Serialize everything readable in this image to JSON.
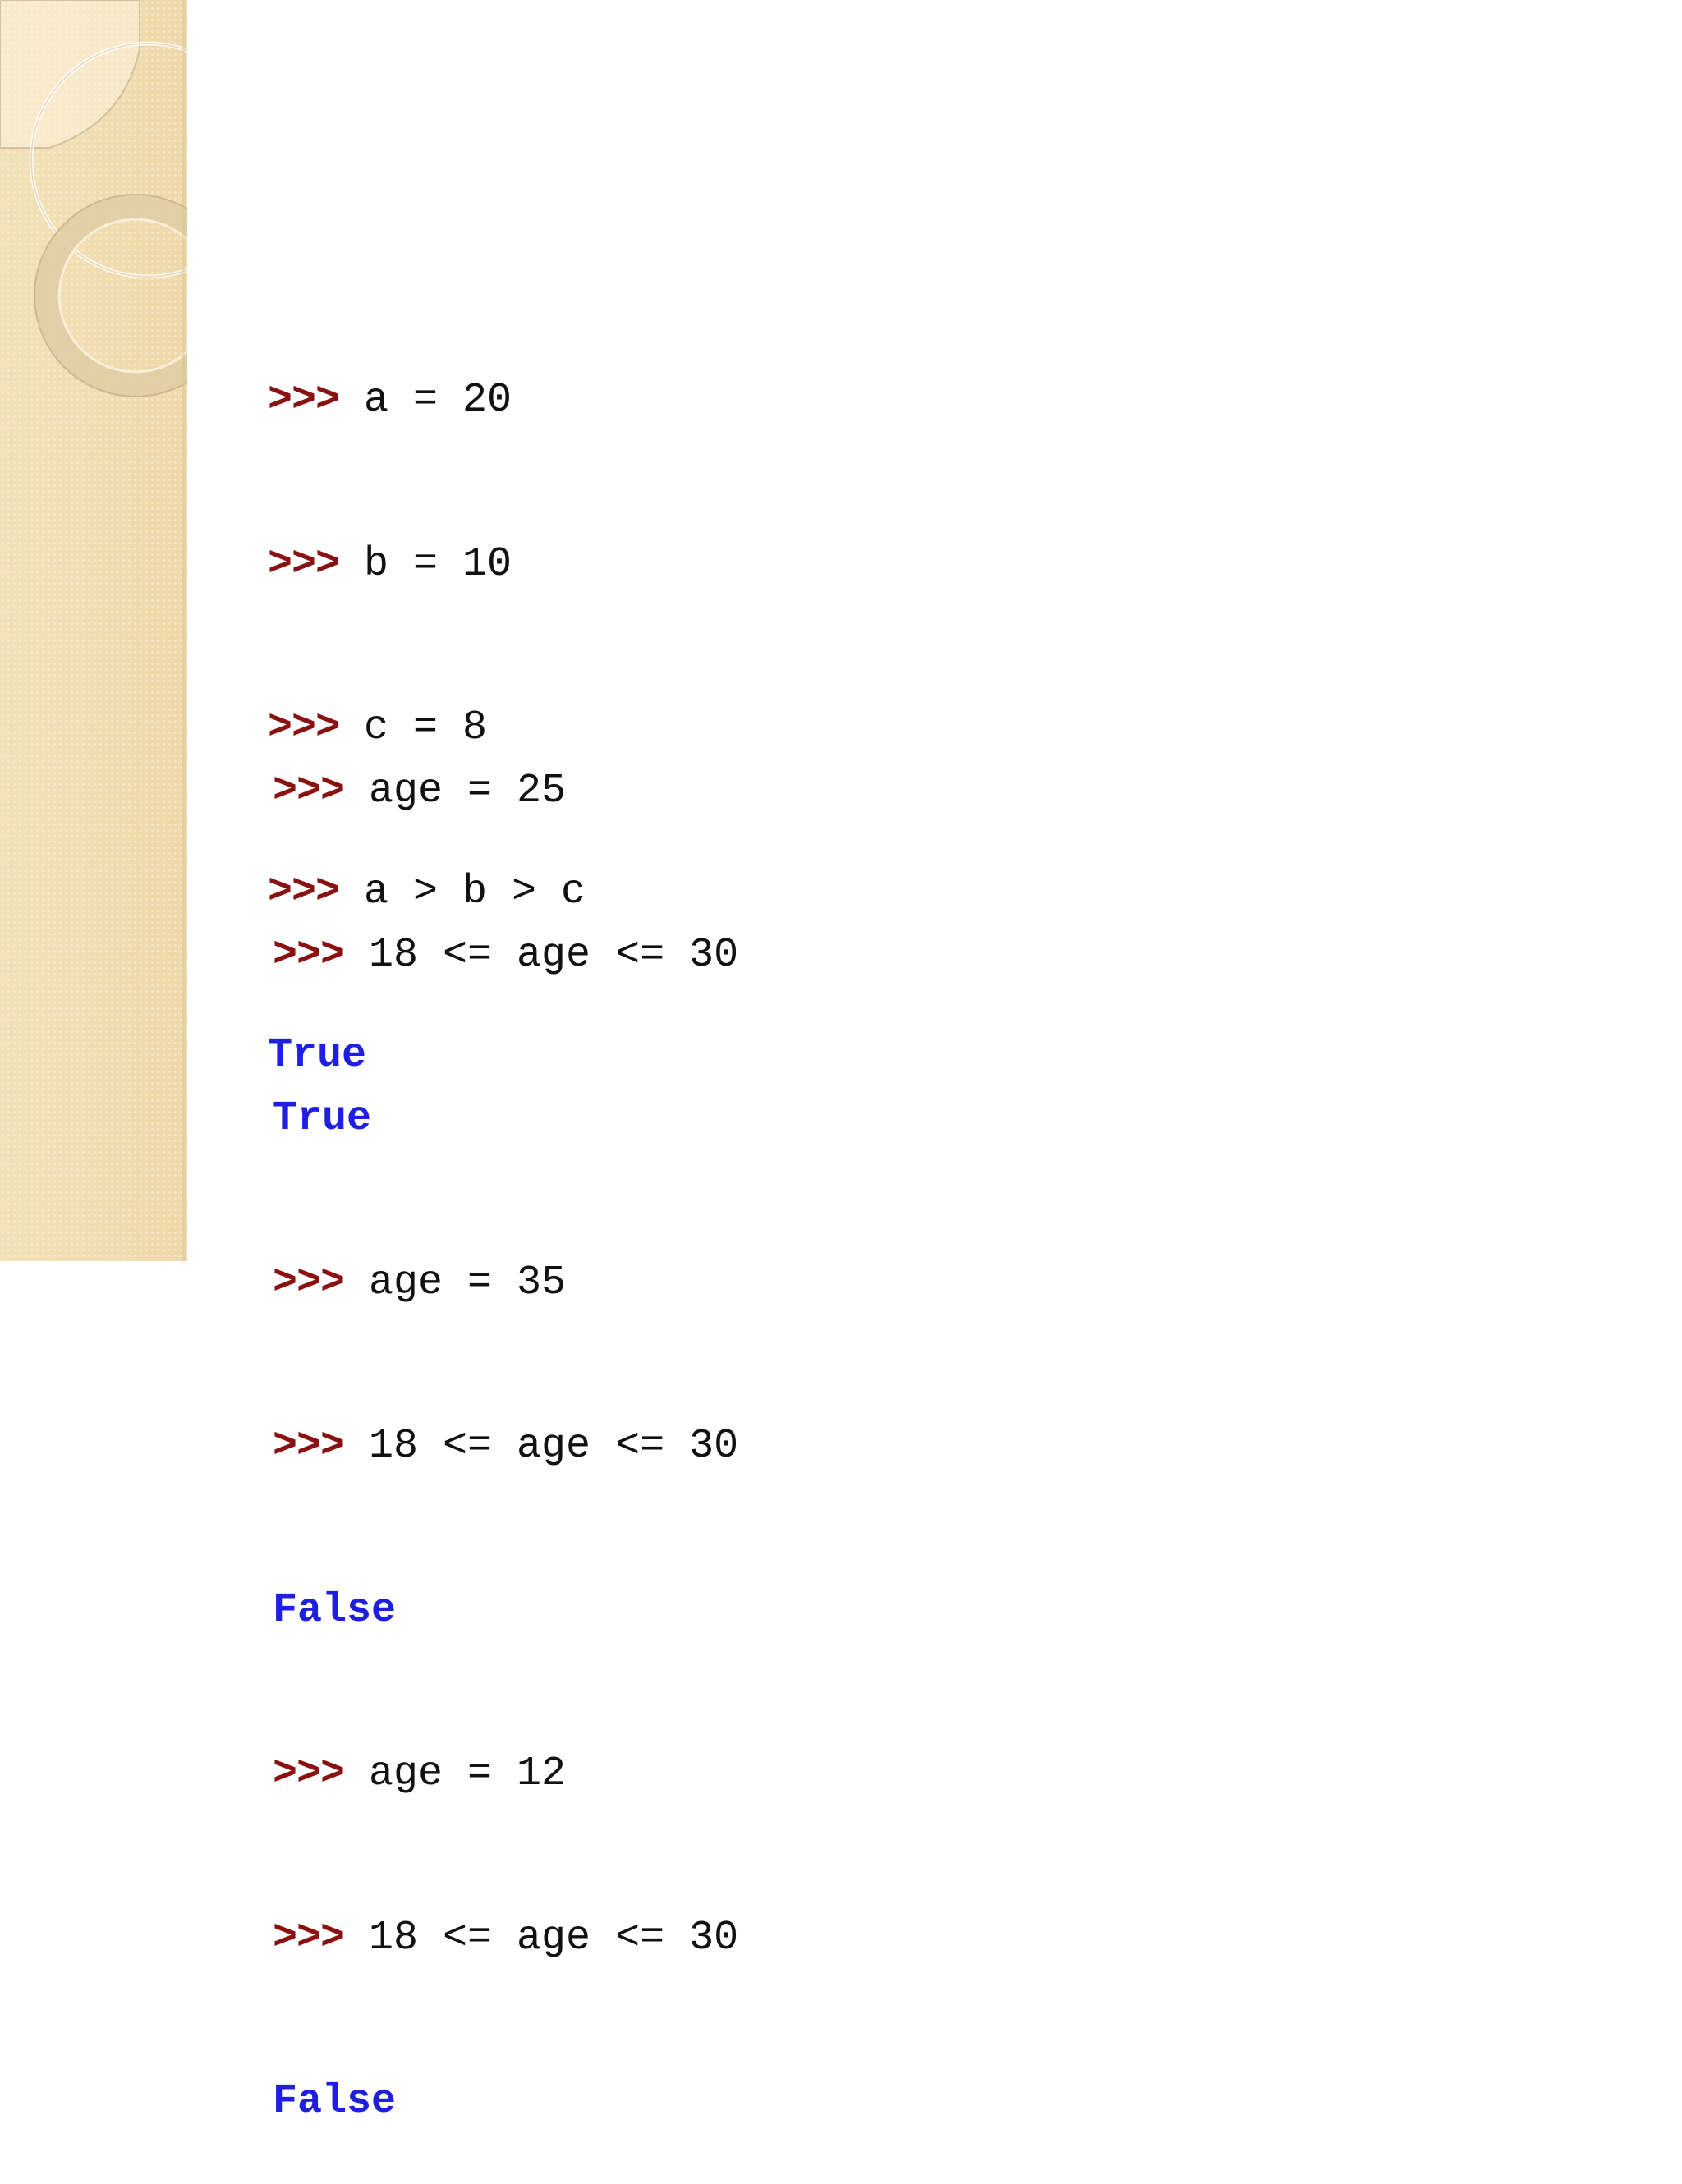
{
  "slide": {
    "block1": [
      {
        "prompt": ">>>",
        "code": " a = 20"
      },
      {
        "prompt": ">>>",
        "code": " b = 10"
      },
      {
        "prompt": ">>>",
        "code": " c = 8"
      },
      {
        "prompt": ">>>",
        "code": " a > b > c"
      },
      {
        "output": "True"
      }
    ],
    "block2": [
      {
        "prompt": ">>>",
        "code": " age = 25"
      },
      {
        "prompt": ">>>",
        "code": " 18 <= age <= 30"
      },
      {
        "output": "True"
      },
      {
        "prompt": ">>>",
        "code": " age = 35"
      },
      {
        "prompt": ">>>",
        "code": " 18 <= age <= 30"
      },
      {
        "output": "False"
      },
      {
        "prompt": ">>>",
        "code": " age = 12"
      },
      {
        "prompt": ">>>",
        "code": " 18 <= age <= 30"
      },
      {
        "output": "False"
      }
    ]
  },
  "colors": {
    "prompt": "#8b1010",
    "output": "#1f1fe0",
    "sidebar": "#f2dfb4"
  },
  "icons": {
    "sidebar_decoration": "overlapping-rings-decoration"
  }
}
